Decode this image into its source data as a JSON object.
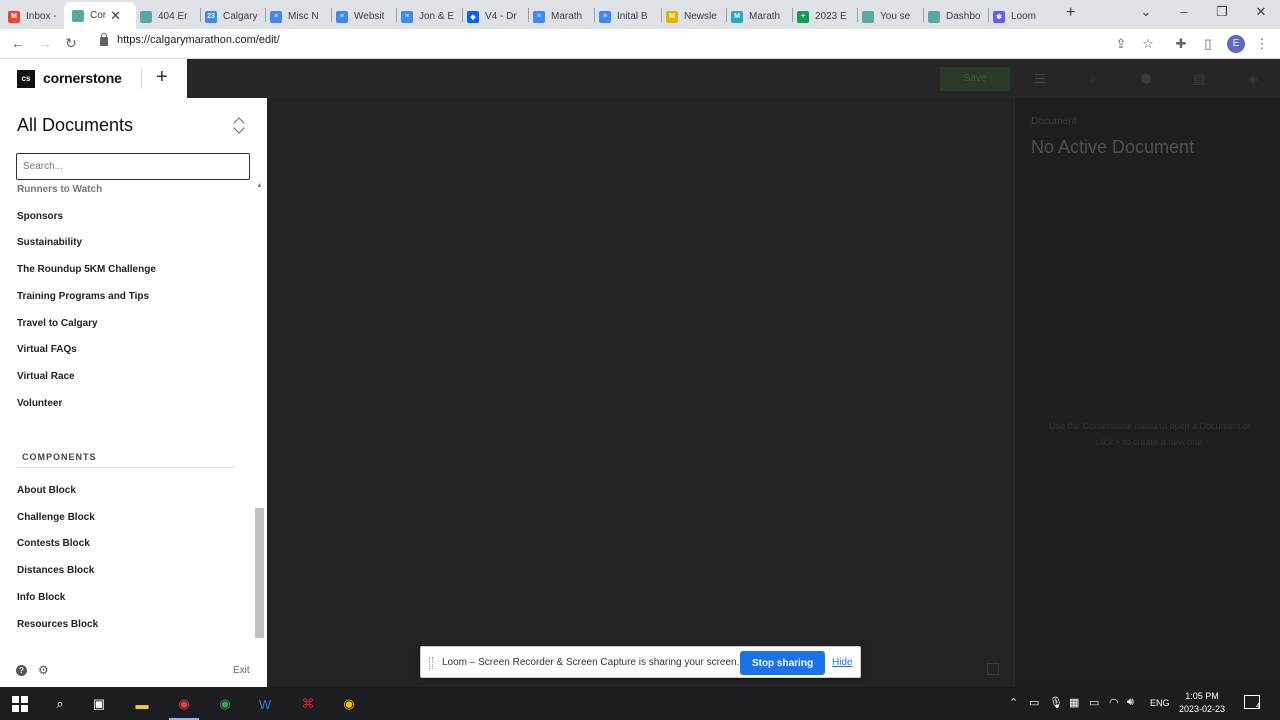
{
  "browser": {
    "tabs": [
      {
        "title": "Inbox -",
        "favicon": "gmail-icon",
        "color": "#ea4335",
        "glyph": "M"
      },
      {
        "title": "Cor",
        "favicon": "cornerstone-icon",
        "color": "#5aa9a0",
        "glyph": "",
        "active": true
      },
      {
        "title": "404 Er",
        "favicon": "site-icon",
        "color": "#5aa9a0",
        "glyph": ""
      },
      {
        "title": "Calgary",
        "favicon": "calendar-icon",
        "color": "#4285f4",
        "glyph": "23"
      },
      {
        "title": "Misc N",
        "favicon": "docs-icon",
        "color": "#4285f4",
        "glyph": "≡"
      },
      {
        "title": "Websit",
        "favicon": "docs-icon",
        "color": "#4285f4",
        "glyph": "≡"
      },
      {
        "title": "Jon & E",
        "favicon": "docs-icon",
        "color": "#4285f4",
        "glyph": "≡"
      },
      {
        "title": "V4 - Dr",
        "favicon": "dropbox-icon",
        "color": "#0061ff",
        "glyph": "◆"
      },
      {
        "title": "Marath",
        "favicon": "docs-icon",
        "color": "#4285f4",
        "glyph": "≡"
      },
      {
        "title": "Inital B",
        "favicon": "docs-icon",
        "color": "#4285f4",
        "glyph": "≡"
      },
      {
        "title": "Newsle",
        "favicon": "mailchimp-icon",
        "color": "#e0b400",
        "glyph": "M"
      },
      {
        "title": "Marath",
        "favicon": "mailchimp-icon",
        "color": "#2aa7c6",
        "glyph": "M"
      },
      {
        "title": "2023 E",
        "favicon": "sheets-icon",
        "color": "#0f9d58",
        "glyph": "+"
      },
      {
        "title": "You se",
        "favicon": "site-icon",
        "color": "#5aa9a0",
        "glyph": ""
      },
      {
        "title": "Dashbo",
        "favicon": "site-icon",
        "color": "#5aa9a0",
        "glyph": ""
      },
      {
        "title": "Loom",
        "favicon": "loom-icon",
        "color": "#625df5",
        "glyph": "✱"
      }
    ],
    "url": "https://calgarymarathon.com/edit/",
    "profile_initial": "E"
  },
  "editor": {
    "brand_logo": "cs",
    "brand_name": "cornerstone",
    "save_label": "Save",
    "inspector_label": "Document",
    "inspector_title": "No Active Document",
    "inspector_help": "Use the Cornerstone menu to open a Document or click + to create a new one."
  },
  "sidebar": {
    "title": "All Documents",
    "search_placeholder": "Search...",
    "partial_item": "Runners to Watch",
    "documents": [
      "Sponsors",
      "Sustainability",
      "The Roundup 5KM Challenge",
      "Training Programs and Tips",
      "Travel to Calgary",
      "Virtual FAQs",
      "Virtual Race",
      "Volunteer"
    ],
    "components_heading": "COMPONENTS",
    "components": [
      "About Block",
      "Challenge Block",
      "Contests Block",
      "Distances Block",
      "Info Block",
      "Resources Block"
    ],
    "exit_label": "Exit"
  },
  "loom_bar": {
    "message": "Loom – Screen Recorder & Screen Capture is sharing your screen.",
    "stop_label": "Stop sharing",
    "hide_label": "Hide"
  },
  "taskbar": {
    "language": "ENG",
    "time": "1:05 PM",
    "date": "2023-02-23",
    "notification_count": "4"
  }
}
